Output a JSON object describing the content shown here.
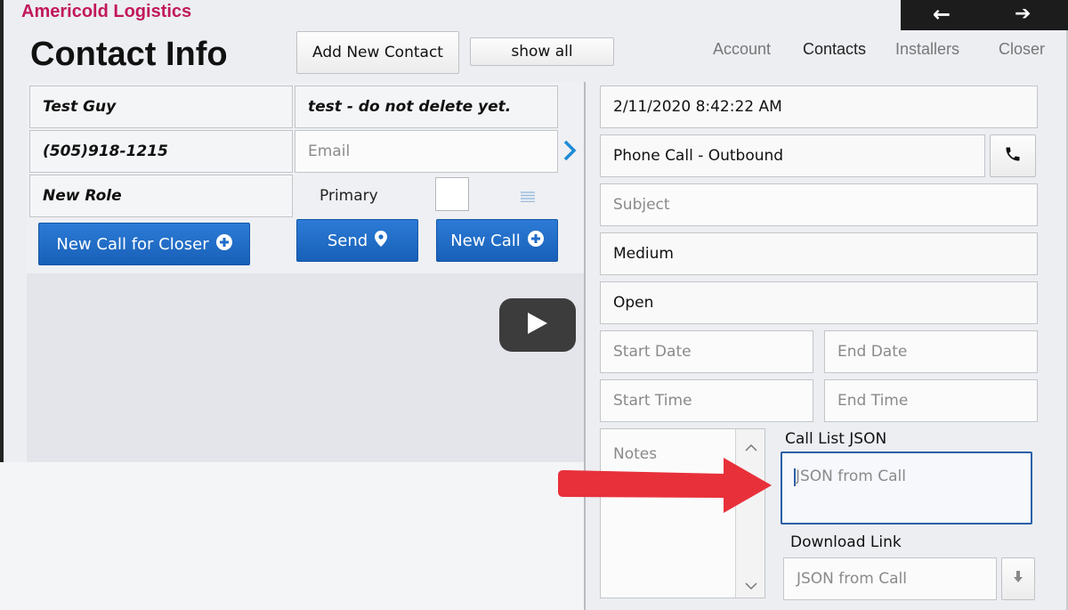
{
  "app": {
    "company": "Americold Logistics"
  },
  "nav": {
    "back_glyph": "←",
    "forward_glyph": "➔"
  },
  "header": {
    "title": "Contact Info",
    "add_contact": "Add New Contact",
    "show_all": "show all",
    "tabs": [
      "Account",
      "Contacts",
      "Installers",
      "Closer"
    ],
    "active_tab": "Contacts"
  },
  "contact": {
    "name": "Test Guy",
    "note": "test - do not delete yet.",
    "phone": "(505)918-1215",
    "email_placeholder": "Email",
    "role": "New Role",
    "primary_label": "Primary",
    "new_call_closer": "New Call for Closer",
    "send": "Send",
    "new_call": "New Call"
  },
  "call": {
    "datetime": "2/11/2020 8:42:22 AM",
    "type": "Phone Call - Outbound",
    "subject_placeholder": "Subject",
    "priority": "Medium",
    "status": "Open",
    "start_date_placeholder": "Start Date",
    "end_date_placeholder": "End Date",
    "start_time_placeholder": "Start Time",
    "end_time_placeholder": "End Time",
    "notes_placeholder": "Notes",
    "json_label": "Call List JSON",
    "json_placeholder": "JSON from Call",
    "download_label": "Download Link",
    "download_placeholder": "JSON from Call"
  },
  "colors": {
    "brand": "#c2185b",
    "accent_blue": "#1e6cc8",
    "arrow_red": "#e8303a"
  },
  "icons": [
    "phone-icon",
    "plus-circle-icon",
    "map-pin-icon",
    "chevron-right-icon",
    "download-icon",
    "play-icon",
    "list-icon"
  ]
}
